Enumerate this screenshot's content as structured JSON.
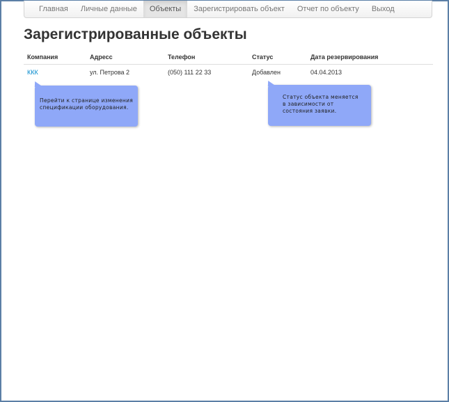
{
  "nav": {
    "items": [
      {
        "label": "Главная"
      },
      {
        "label": "Личные данные"
      },
      {
        "label": "Объекты",
        "active": true
      },
      {
        "label": "Зарегистрировать объект"
      },
      {
        "label": "Отчет по объекту"
      },
      {
        "label": "Выход"
      }
    ]
  },
  "page": {
    "title": "Зарегистрированные объекты"
  },
  "table": {
    "headers": [
      "Компания",
      "Адресс",
      "Телефон",
      "Статус",
      "Дата резервирования"
    ],
    "rows": [
      {
        "company": "ККК",
        "address": "ул. Петрова 2",
        "phone": "(050) 111 22 33",
        "status": "Добавлен",
        "date": "04.04.2013"
      }
    ]
  },
  "callouts": {
    "company_hint": {
      "line1": "Перейти к странице изменения",
      "line2": "спецификации оборудования."
    },
    "status_hint": {
      "line1": "Статус объекта меняется",
      "line2": "в зависимости от",
      "line3": "состояния заявки."
    }
  },
  "colors": {
    "link": "#0088cc",
    "callout_bg": "#8fa8f8",
    "frame": "#5b7fa6"
  }
}
